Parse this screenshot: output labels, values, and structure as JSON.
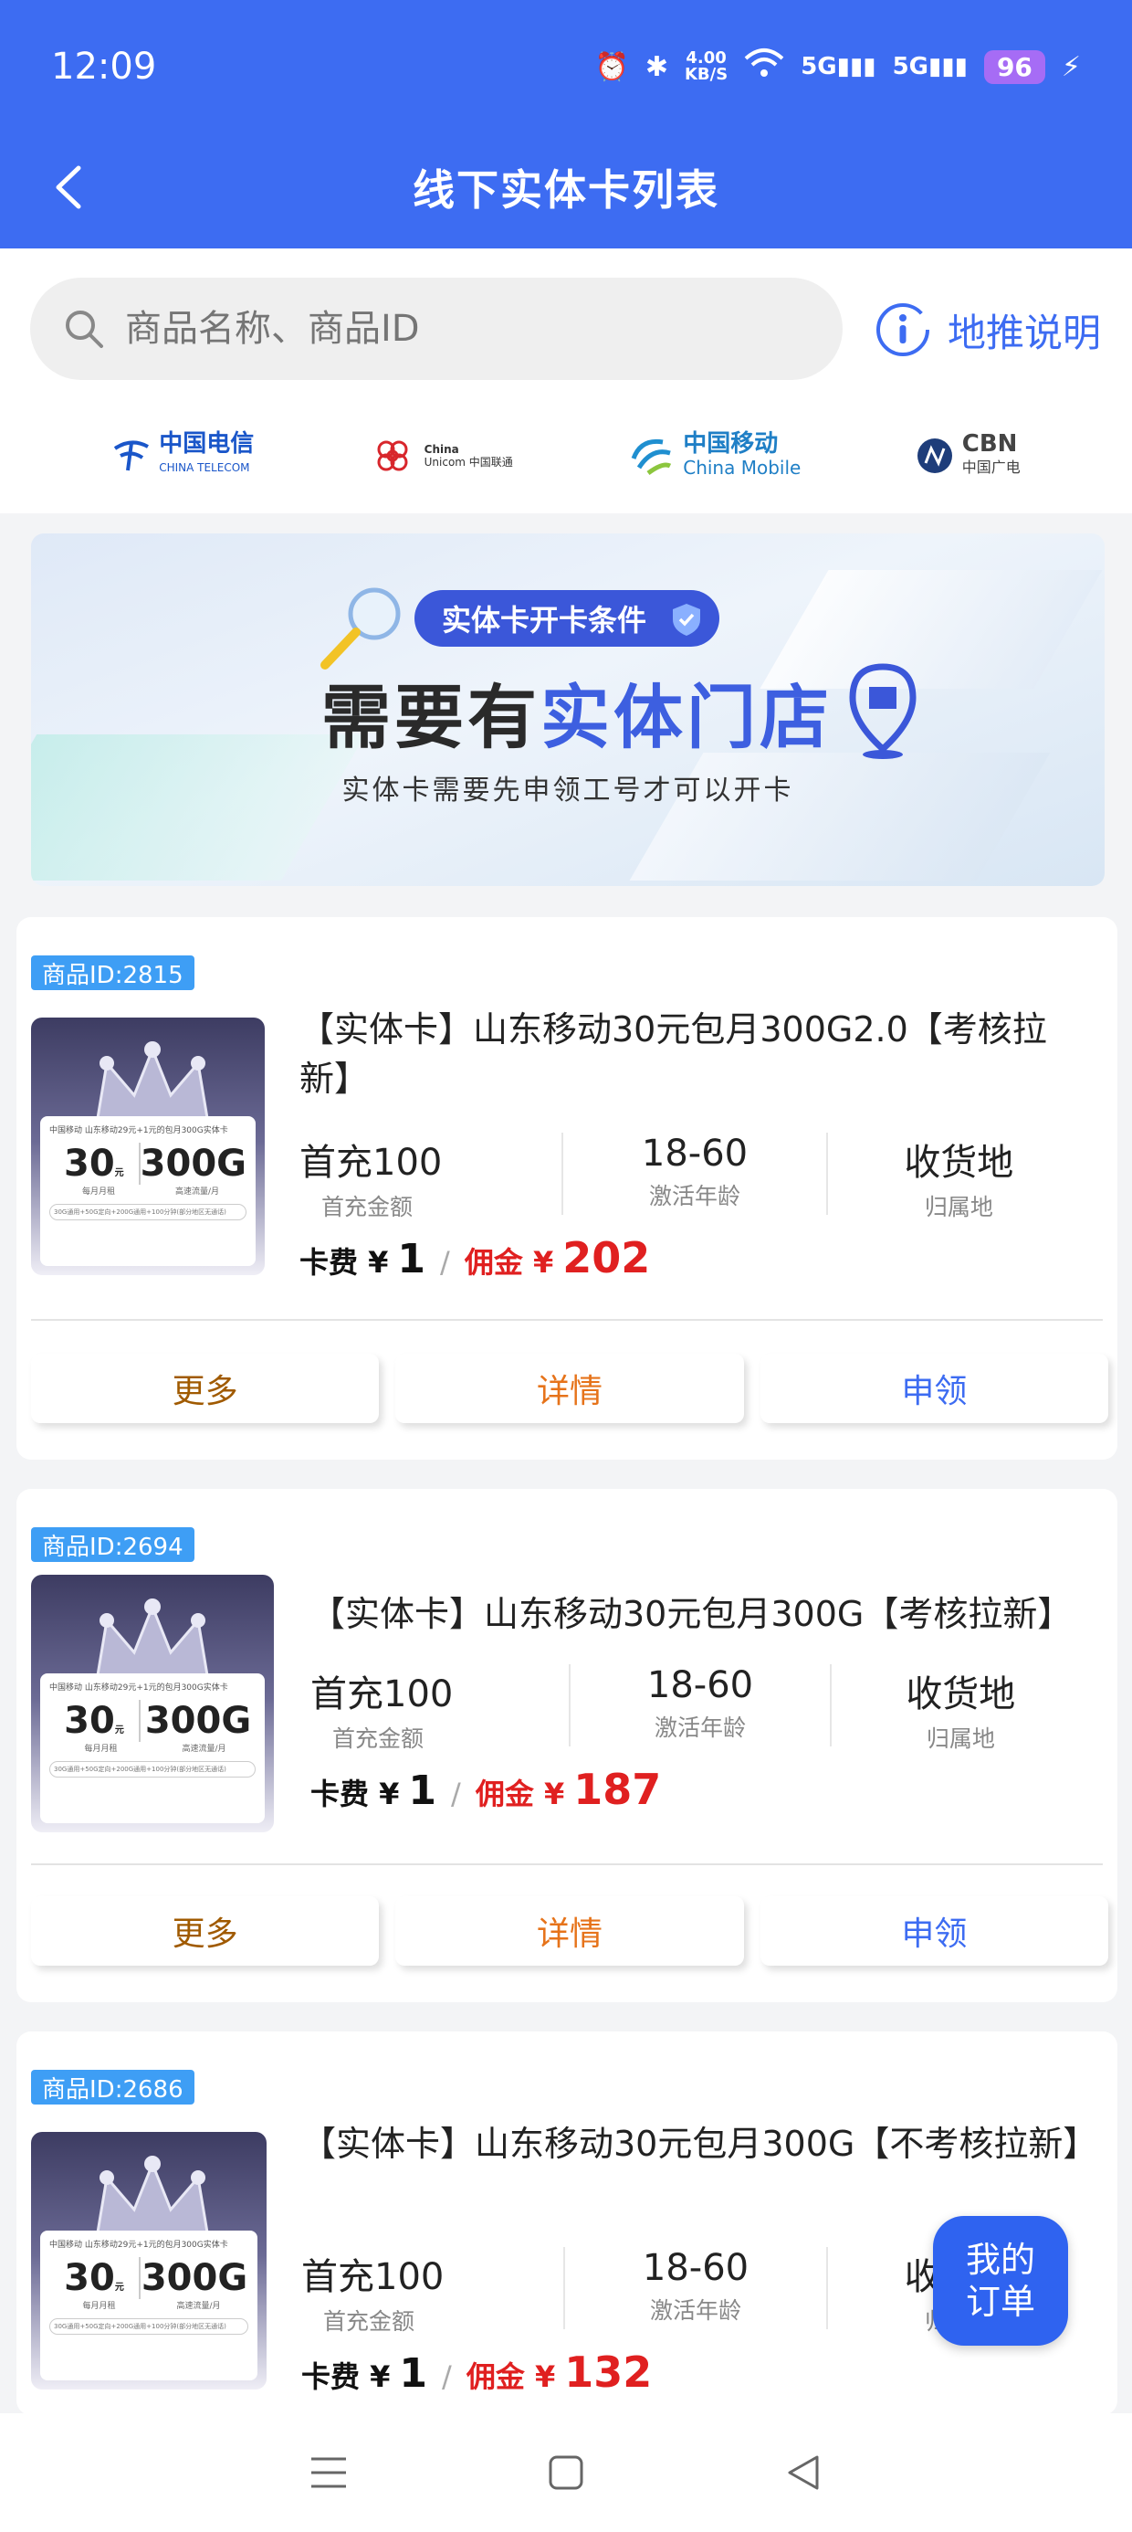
{
  "status_bar": {
    "time": "12:09",
    "net_speed_value": "4.00",
    "net_speed_unit": "KB/S",
    "signal1": "5G",
    "signal2": "5G",
    "battery": "96"
  },
  "header": {
    "title": "线下实体卡列表"
  },
  "search": {
    "placeholder": "商品名称、商品ID"
  },
  "help_link": "地推说明",
  "carriers": [
    {
      "name": "中国电信",
      "sub": "CHINA TELECOM"
    },
    {
      "name": "China",
      "sub": "Unicom 中国联通"
    },
    {
      "name": "中国移动",
      "sub": "China Mobile"
    },
    {
      "name": "CBN",
      "sub": "中国广电"
    }
  ],
  "banner": {
    "tag": "实体卡开卡条件",
    "headline_prefix": "需要有",
    "headline_highlight": "实体门店",
    "subline": "实体卡需要先申领工号才可以开卡"
  },
  "thumb": {
    "header": "中国移动  山东移动29元+1元的包月300G实体卡",
    "amount": "30",
    "amount_unit": "元",
    "data": "300G",
    "cap_left": "每月月租",
    "cap_right": "高速流量/月",
    "footer": "30G通用+50G定向+200G通用+100分钟(部分地区无通话)"
  },
  "labels": {
    "fee": "卡费",
    "commission": "佣金",
    "yen": "¥",
    "sep": "/",
    "more": "更多",
    "detail": "详情",
    "claim": "申领"
  },
  "products": [
    {
      "id_label": "商品ID:2815",
      "title": "【实体卡】山东移动30元包月300G2.0【考核拉新】",
      "first_charge": "首充100",
      "first_charge_label": "首充金额",
      "age": "18-60",
      "age_label": "激活年龄",
      "location": "收货地",
      "location_label": "归属地",
      "fee": "1",
      "commission": "202"
    },
    {
      "id_label": "商品ID:2694",
      "title": "【实体卡】山东移动30元包月300G【考核拉新】",
      "first_charge": "首充100",
      "first_charge_label": "首充金额",
      "age": "18-60",
      "age_label": "激活年龄",
      "location": "收货地",
      "location_label": "归属地",
      "fee": "1",
      "commission": "187"
    },
    {
      "id_label": "商品ID:2686",
      "title": "【实体卡】山东移动30元包月300G【不考核拉新】",
      "first_charge": "首充100",
      "first_charge_label": "首充金额",
      "age": "18-60",
      "age_label": "激活年龄",
      "location": "收货地",
      "location_label": "归属地",
      "fee": "1",
      "commission": "132"
    }
  ],
  "fab": {
    "line1": "我的",
    "line2": "订单"
  },
  "colors": {
    "primary": "#3d6cf2",
    "badge": "#3e9ef5",
    "commission": "#e02020"
  }
}
